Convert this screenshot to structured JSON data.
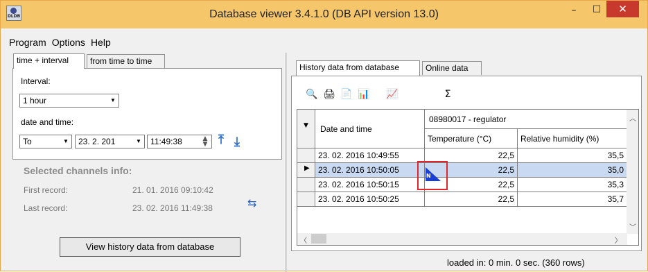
{
  "window": {
    "title": "Database viewer  3.4.1.0  (DB API version 13.0)",
    "app_icon_text": "DLDB",
    "controls": {
      "minimize": "–",
      "maximize": "□",
      "close": "✕"
    }
  },
  "menu": [
    "Program",
    "Options",
    "Help"
  ],
  "left_tabs": [
    "time + interval",
    "from time to time"
  ],
  "interval": {
    "label": "Interval:",
    "value": "1 hour"
  },
  "datetime": {
    "label": "date and time:",
    "direction": "To",
    "date": "23. 2. 201",
    "time": "11:49:38"
  },
  "selected_info": {
    "heading": "Selected channels info:",
    "first_label": "First record:",
    "first_value": "21. 01. 2016  09:10:42",
    "last_label": "Last record:",
    "last_value": "23. 02. 2016  11:49:38"
  },
  "view_button": "View history data from database",
  "right_tabs": [
    "History data from database",
    "Online data"
  ],
  "toolbar_icons": [
    "preview-icon",
    "print-icon",
    "pdf-export-icon",
    "csv-export-icon",
    "graph-icon",
    "statistics-icon"
  ],
  "grid": {
    "group_header": "08980017 - regulator",
    "date_header": "Date and time",
    "col1": "Temperature (°C)",
    "col2": "Relative humidity (%)",
    "rows": [
      {
        "date": "23. 02. 2016  10:49:55",
        "temp": "22,5",
        "rh": "35,5"
      },
      {
        "date": "23. 02. 2016  10:50:05",
        "temp": "22,5",
        "rh": "35,0"
      },
      {
        "date": "23. 02. 2016  10:50:15",
        "temp": "22,5",
        "rh": "35,3"
      },
      {
        "date": "23. 02. 2016  10:50:25",
        "temp": "22,5",
        "rh": "35,7"
      }
    ]
  },
  "status": "loaded in:   0 min. 0 sec. (360 rows)"
}
